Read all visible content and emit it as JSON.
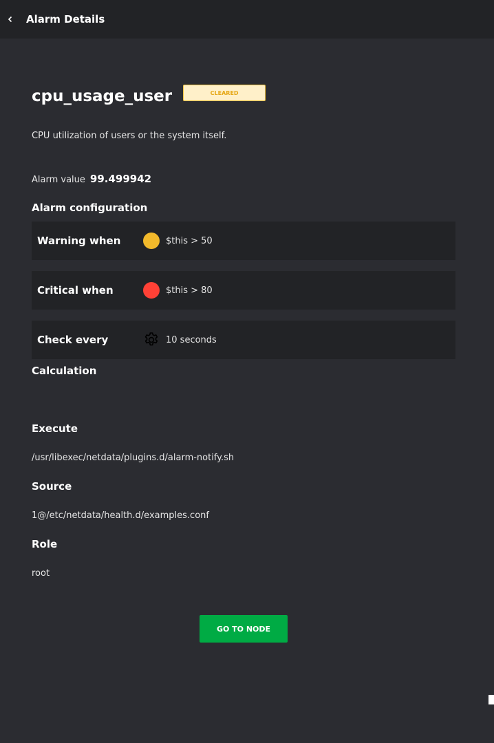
{
  "header": {
    "back_icon": "chevron-left-icon",
    "title": "Alarm Details"
  },
  "alarm": {
    "name": "cpu_usage_user",
    "status": "CLEARED",
    "status_colors": {
      "background": "#fff0c9",
      "border": "#f0c23c",
      "text": "#e6a817"
    },
    "description": "CPU utilization of users or the system itself.",
    "value_label": "Alarm value",
    "value": "99.499942"
  },
  "configuration": {
    "heading": "Alarm configuration",
    "rows": [
      {
        "label": "Warning when",
        "icon": "warning-dot-icon",
        "color": "#f2b92b",
        "value": "$this > 50"
      },
      {
        "label": "Critical when",
        "icon": "critical-dot-icon",
        "color": "#ff4136",
        "value": "$this > 80"
      },
      {
        "label": "Check every",
        "icon": "gear-icon",
        "value": "10 seconds"
      }
    ]
  },
  "calculation": {
    "heading": "Calculation",
    "value": ""
  },
  "execute": {
    "heading": "Execute",
    "value": "/usr/libexec/netdata/plugins.d/alarm-notify.sh"
  },
  "source": {
    "heading": "Source",
    "value": "1@/etc/netdata/health.d/examples.conf"
  },
  "role": {
    "heading": "Role",
    "value": "root"
  },
  "actions": {
    "go_to_node_label": "GO TO NODE",
    "go_to_node_color": "#00ab44"
  }
}
